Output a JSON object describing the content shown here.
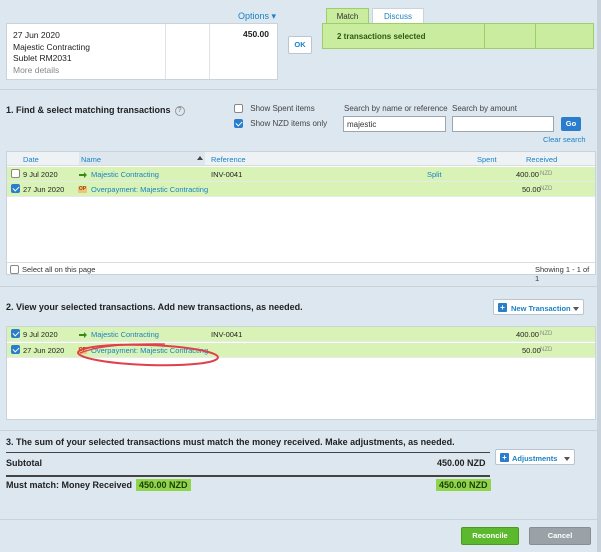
{
  "statement": {
    "date": "27 Jun 2020",
    "payee": "Majestic Contracting",
    "reference": "Sublet RM2031",
    "more_link": "More details",
    "amount": "450.00"
  },
  "options_label": "Options ▾",
  "ok_label": "OK",
  "tabs": {
    "match": "Match",
    "discuss": "Discuss"
  },
  "match_summary": "2 transactions selected",
  "section1": {
    "title": "1. Find & select matching transactions",
    "help": "?",
    "show_spent": "Show Spent items",
    "show_nzd": "Show NZD items only",
    "search_name_label": "Search by name or reference",
    "search_name_value": "majestic",
    "search_amount_label": "Search by amount",
    "search_amount_value": "",
    "go": "Go",
    "clear_search": "Clear search"
  },
  "table1": {
    "headers": {
      "date": "Date",
      "name": "Name",
      "reference": "Reference",
      "spent": "Spent",
      "received": "Received"
    },
    "rows": [
      {
        "date": "9 Jul 2020",
        "name": "Majestic Contracting",
        "reference": "INV-0041",
        "split": "Split",
        "received": "400.00",
        "currency": "NZD",
        "checked": false
      },
      {
        "date": "27 Jun 2020",
        "name": "Overpayment: Majestic Contracting",
        "reference": "",
        "split": "",
        "received": "50.00",
        "currency": "NZD",
        "checked": true
      }
    ],
    "select_all": "Select all on this page",
    "showing": "Showing 1 - 1 of 1"
  },
  "section2": {
    "title": "2. View your selected transactions. Add new transactions, as needed.",
    "new_transaction": "New Transaction",
    "rows": [
      {
        "date": "9 Jul 2020",
        "name": "Majestic Contracting",
        "reference": "INV-0041",
        "received": "400.00",
        "currency": "NZD"
      },
      {
        "date": "27 Jun 2020",
        "name": "Overpayment: Majestic Contracting",
        "reference": "",
        "received": "50.00",
        "currency": "NZD"
      }
    ]
  },
  "section3": {
    "title": "3. The sum of your selected transactions must match the money received. Make adjustments, as needed.",
    "adjustments": "Adjustments",
    "subtotal_label": "Subtotal",
    "subtotal_value": "450.00 NZD",
    "must_match_label": "Must match: Money Received",
    "must_match_badge": "450.00 NZD",
    "must_match_value": "450.00 NZD"
  },
  "buttons": {
    "reconcile": "Reconcile",
    "cancel": "Cancel"
  },
  "colors": {
    "accent": "#1a82c4",
    "match_green": "#c9ec9f",
    "row_green": "#d9f3b6",
    "reconcile": "#5cb82c",
    "highlight_circle": "#e0404a"
  }
}
